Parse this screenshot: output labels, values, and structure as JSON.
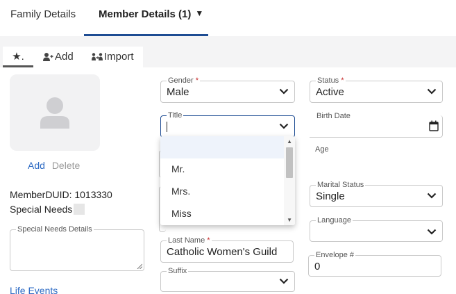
{
  "top_tabs": {
    "family": "Family Details",
    "member": "Member Details (1)",
    "member_caret": "▼"
  },
  "sub_tabs": {
    "favorites": "★.",
    "add": "Add",
    "import": "Import"
  },
  "photo": {
    "add": "Add",
    "delete": "Delete"
  },
  "member": {
    "duid_text": "MemberDUID: 1013330",
    "special_needs_label": "Special Needs",
    "special_needs_details_label": "Special Needs Details",
    "life_events": "Life Events"
  },
  "fields": {
    "gender": {
      "label": "Gender",
      "required": "*",
      "value": "Male"
    },
    "title": {
      "label": "Title",
      "value": ""
    },
    "last_name": {
      "label": "Last Name",
      "required": "*",
      "value": "Catholic Women's Guild"
    },
    "suffix": {
      "label": "Suffix",
      "value": ""
    },
    "status": {
      "label": "Status",
      "required": "*",
      "value": "Active"
    },
    "birth_date": {
      "label": "Birth Date",
      "value": ""
    },
    "age": {
      "label": "Age"
    },
    "marital_status": {
      "label": "Marital Status",
      "value": "Single"
    },
    "language": {
      "label": "Language",
      "value": ""
    },
    "envelope": {
      "label": "Envelope #",
      "value": "0"
    }
  },
  "title_dropdown": {
    "options": [
      "",
      "Mr.",
      "Mrs.",
      "Miss"
    ]
  },
  "colors": {
    "accent": "#1e4c93",
    "link": "#2e6bc4",
    "required": "#c62828"
  }
}
